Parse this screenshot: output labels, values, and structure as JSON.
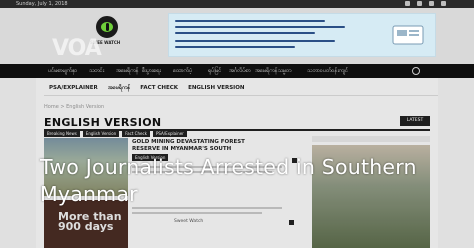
{
  "topbar": {
    "date": "Sunday, July 1, 2018"
  },
  "header": {
    "logo_text": "VOA",
    "partner_logo_text": "SWEE WATCH",
    "banner_alt": "Burmese-language advertisement banner"
  },
  "nav": {
    "items": [
      "ပင်မစာမျက်နှာ",
      "သတင်း",
      "အမေရိကန်",
      "စီးပွားရေး",
      "ထောက်ပံ့",
      "ရုပ်မြင်",
      "အင်္ဂလိပ်စာ",
      "အမေရိကန်သမ္မတ",
      "သဘာဝပတ်ဝန်းကျင်"
    ]
  },
  "subnav": {
    "tabs": [
      "PSA/EXPLAINER",
      "အမေရိကန်",
      "FACT CHECK",
      "ENGLISH VERSION"
    ]
  },
  "breadcrumb": "Home > English Version",
  "section_title": "ENGLISH VERSION",
  "latest_button": "LATEST",
  "tags": [
    "Breaking News",
    "English Version",
    "Fact Check",
    "PSA/Explainer"
  ],
  "story": {
    "title": "GOLD MINING DEVASTATING FOREST RESERVE IN MYANMAR'S SOUTH",
    "tag": "English Version",
    "thumb_text": "More than 900 days",
    "small_caption": "Sweet Watch"
  },
  "headline": "Two Journalists Arrested in Southern Myanmar",
  "colors": {
    "nav_bg": "#111111",
    "banner_bg": "#d6ebf4",
    "tag_bg": "#222222"
  }
}
